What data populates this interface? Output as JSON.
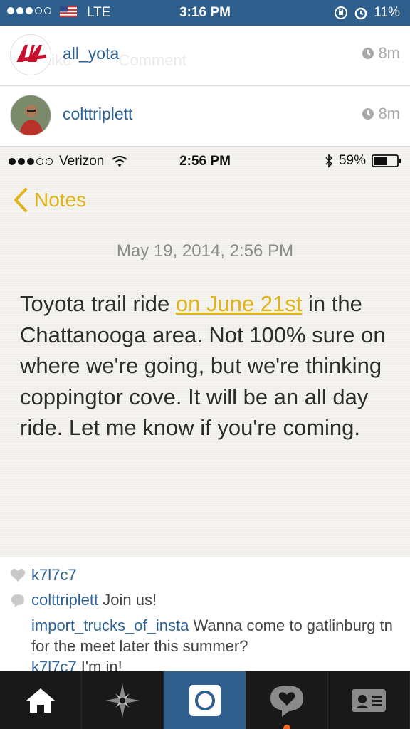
{
  "status_bar": {
    "carrier": "LTE",
    "time": "3:16 PM",
    "battery": "11%"
  },
  "faded_actions": {
    "like": "Like",
    "comment": "Comment"
  },
  "posts": [
    {
      "username": "all_yota",
      "time_ago": "8m"
    },
    {
      "username": "colttriplett",
      "time_ago": "8m"
    }
  ],
  "notes_screenshot": {
    "carrier": "Verizon",
    "time": "2:56 PM",
    "battery": "59%",
    "back_label": "Notes",
    "date": "May 19, 2014, 2:56 PM",
    "text_before_link": "Toyota trail ride ",
    "link_text": "on June 21st",
    "text_after_link": " in the Chattanooga area. Not 100% sure on where we're going, but we're thinking coppingtor cove. It will be an all day ride. Let me know if you're coming."
  },
  "likes": {
    "user": "k7l7c7"
  },
  "comments": [
    {
      "user": "colttriplett",
      "text": " Join us!"
    },
    {
      "user": "import_trucks_of_insta",
      "text": " Wanna come to gatlinburg tn for the meet later this summer?"
    },
    {
      "user": "k7l7c7",
      "text": " I'm in!"
    }
  ],
  "tabs": [
    {
      "name": "home",
      "icon": "home-icon"
    },
    {
      "name": "explore",
      "icon": "explore-icon"
    },
    {
      "name": "camera",
      "icon": "camera-icon"
    },
    {
      "name": "activity",
      "icon": "activity-icon"
    },
    {
      "name": "profile",
      "icon": "profile-icon"
    }
  ],
  "colors": {
    "instagram_blue": "#2f5f8c",
    "notes_yellow": "#e0b418",
    "username_blue": "#2d6193"
  }
}
